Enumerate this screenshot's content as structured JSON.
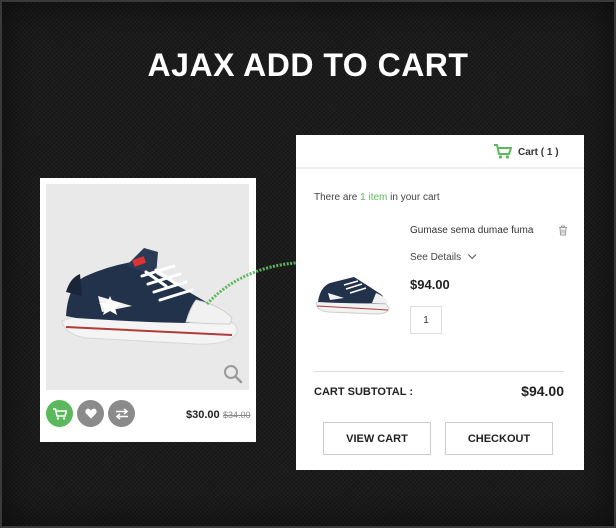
{
  "banner": {
    "title": "AJAX ADD TO CART"
  },
  "product_card": {
    "image": "shoe-product-image",
    "actions": [
      "cart-icon",
      "heart-icon",
      "compare-icon"
    ],
    "price": "$30.00",
    "old_price": "$34.00"
  },
  "cart": {
    "header_label": "Cart ( 1 )",
    "summary_prefix": "There are ",
    "summary_count": "1 item",
    "summary_suffix": " in your cart",
    "item": {
      "name": "Gumase sema dumae fuma",
      "details_label": "See Details",
      "price": "$94.00",
      "quantity": "1"
    },
    "subtotal_label": "CART SUBTOTAL :",
    "subtotal_value": "$94.00",
    "view_cart_label": "VIEW CART",
    "checkout_label": "CHECKOUT"
  },
  "colors": {
    "accent": "#5cb85c",
    "background": "#1c1c1c"
  }
}
